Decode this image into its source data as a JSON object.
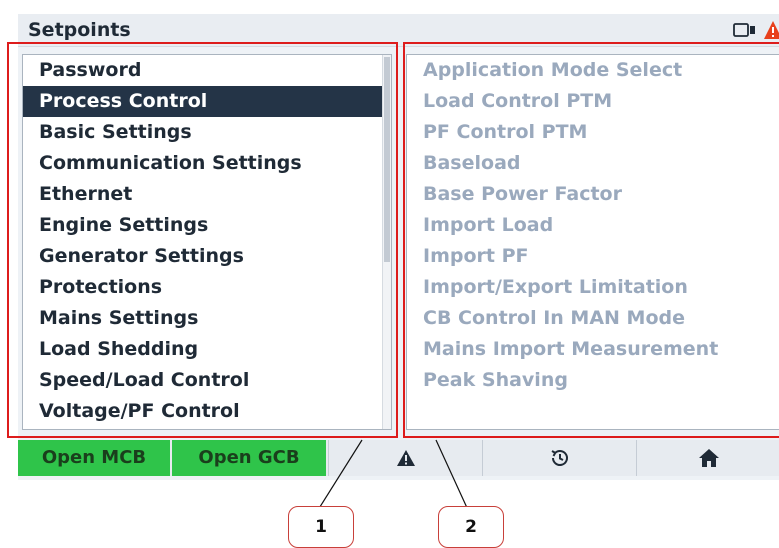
{
  "header": {
    "title": "Setpoints"
  },
  "left_menu": {
    "items": [
      {
        "label": "Password",
        "selected": false
      },
      {
        "label": "Process Control",
        "selected": true
      },
      {
        "label": "Basic Settings",
        "selected": false
      },
      {
        "label": "Communication Settings",
        "selected": false
      },
      {
        "label": "Ethernet",
        "selected": false
      },
      {
        "label": "Engine Settings",
        "selected": false
      },
      {
        "label": "Generator Settings",
        "selected": false
      },
      {
        "label": "Protections",
        "selected": false
      },
      {
        "label": "Mains Settings",
        "selected": false
      },
      {
        "label": "Load Shedding",
        "selected": false
      },
      {
        "label": "Speed/Load Control",
        "selected": false
      },
      {
        "label": "Voltage/PF Control",
        "selected": false
      }
    ]
  },
  "right_menu": {
    "items": [
      "Application Mode Select",
      "Load Control PTM",
      "PF Control PTM",
      "Baseload",
      "Base Power Factor",
      "Import Load",
      "Import PF",
      "Import/Export Limitation",
      "CB Control In MAN Mode",
      "Mains Import Measurement",
      "Peak Shaving"
    ]
  },
  "bottom_bar": {
    "open_mcb": "Open MCB",
    "open_gcb": "Open GCB",
    "icons": [
      "alarm-icon",
      "history-icon",
      "home-icon"
    ]
  },
  "callouts": {
    "label_1": "1",
    "label_2": "2"
  },
  "colors": {
    "highlight": "#dd1c1c",
    "selected_bg": "#243447",
    "button_green": "#2fc44a"
  }
}
